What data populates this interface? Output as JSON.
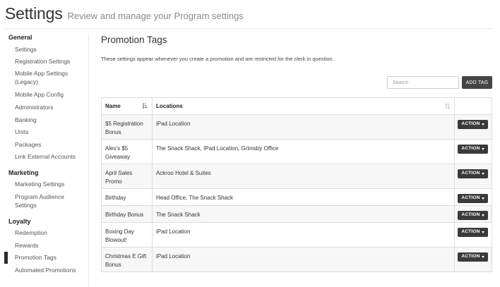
{
  "header": {
    "title": "Settings",
    "subtitle": "Review and manage your Program settings"
  },
  "sidebar": {
    "groups": [
      {
        "label": "General",
        "items": [
          {
            "label": "Settings"
          },
          {
            "label": "Registration Settings"
          },
          {
            "label": "Mobile App Settings (Legacy)"
          },
          {
            "label": "Mobile App Config"
          },
          {
            "label": "Administrators"
          },
          {
            "label": "Banking"
          },
          {
            "label": "Units"
          },
          {
            "label": "Packages"
          },
          {
            "label": "Link External Accounts"
          }
        ]
      },
      {
        "label": "Marketing",
        "items": [
          {
            "label": "Marketing Settings"
          },
          {
            "label": "Program Audience Settings"
          }
        ]
      },
      {
        "label": "Loyalty",
        "items": [
          {
            "label": "Redemption"
          },
          {
            "label": "Rewards"
          },
          {
            "label": "Promotion Tags",
            "active": true
          },
          {
            "label": "Automated Promotions"
          }
        ]
      }
    ]
  },
  "main": {
    "title": "Promotion Tags",
    "description": "These settings appear whenever you create a promotion and are restricted for the clerk in question.",
    "search": {
      "placeholder": "Search",
      "value": ""
    },
    "add_tag_label": "ADD TAG",
    "table": {
      "headers": {
        "name": "Name",
        "locations": "Locations"
      },
      "action_label": "ACTION",
      "rows": [
        {
          "name": "$5 Registration Bonus",
          "locations": "iPad Location"
        },
        {
          "name": "Alex's $5 Giveaway",
          "locations": "The Snack Shack, IPad Location, Grimsby Office"
        },
        {
          "name": "April Sales Promo",
          "locations": "Ackroo Hotel & Suites"
        },
        {
          "name": "Birthday",
          "locations": "Head Office, The Snack Shack"
        },
        {
          "name": "Birthday Bonus",
          "locations": "The Snack Shack"
        },
        {
          "name": "Boxing Day Blowout!",
          "locations": "iPad Location"
        },
        {
          "name": "Christmas E Gift Bonus",
          "locations": "iPad Location"
        }
      ]
    }
  }
}
